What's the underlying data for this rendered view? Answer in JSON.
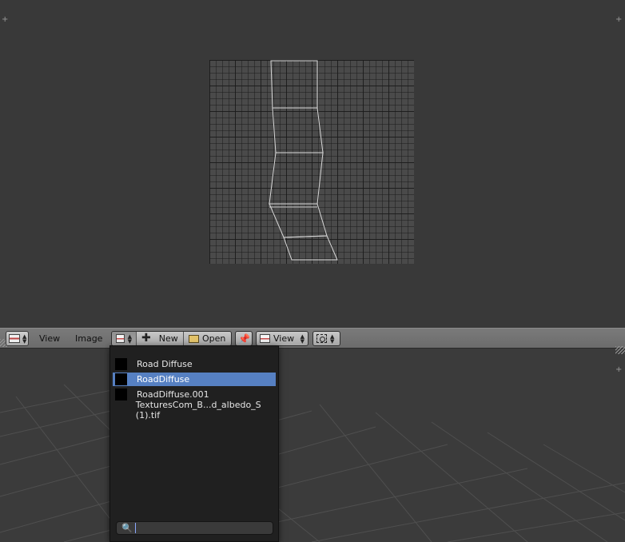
{
  "header": {
    "menus": [
      {
        "label": "View"
      },
      {
        "label": "Image"
      }
    ],
    "new_label": "New",
    "open_label": "Open",
    "view_mode_label": "View"
  },
  "image_browser": {
    "items": [
      {
        "label": "Road Diffuse",
        "thumbnail": "black-swatch",
        "selected": false
      },
      {
        "label": "RoadDiffuse",
        "thumbnail": "black-swatch",
        "selected": true
      },
      {
        "label": "RoadDiffuse.001",
        "thumbnail": "black-swatch",
        "selected": false
      },
      {
        "label": "TexturesCom_B...d_albedo_S (1).tif",
        "thumbnail": "none",
        "selected": false
      }
    ],
    "search_value": ""
  },
  "colors": {
    "selection": "#5680c2",
    "uv_wire": "#d8d8d8",
    "header_bg": "#6c6c6c"
  },
  "icons": [
    "editor-type-icon",
    "image-icon",
    "plus-icon",
    "folder-icon",
    "pin-icon",
    "image-view-icon",
    "pivot-icon",
    "search-icon"
  ]
}
